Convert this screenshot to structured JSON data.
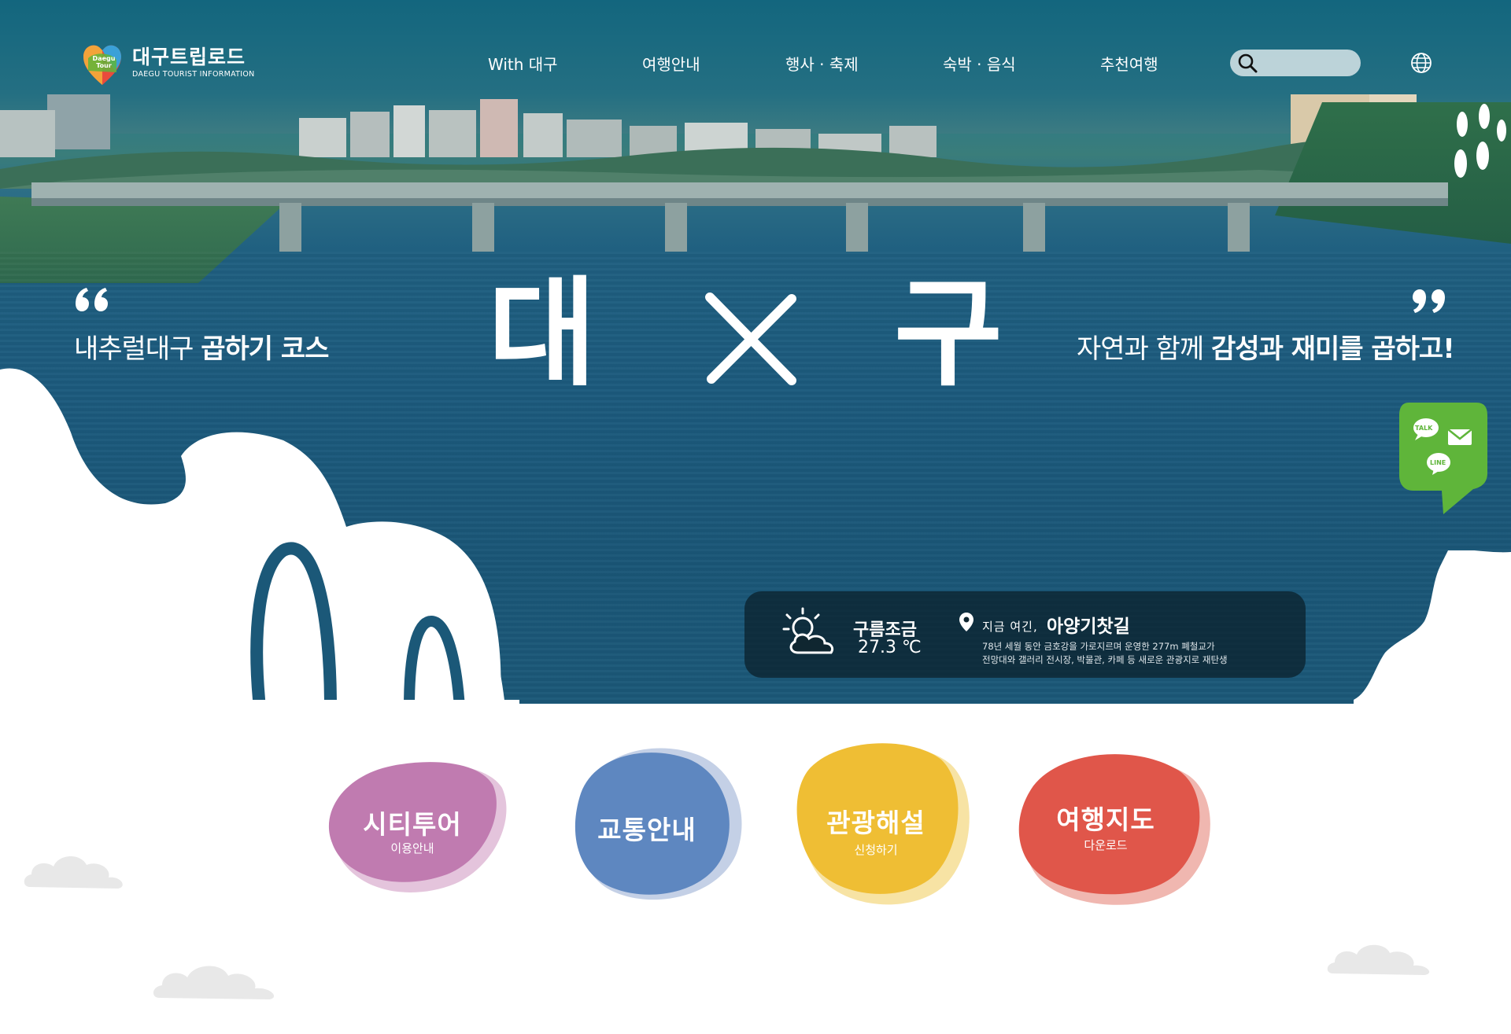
{
  "header": {
    "logo_badge": "Daegu Tour",
    "logo_title": "대구트립로드",
    "logo_subtitle": "DAEGU TOURIST INFORMATION",
    "nav": [
      "With 대구",
      "여행안내",
      "행사 · 축제",
      "숙박 · 음식",
      "추천여행"
    ],
    "search_placeholder": ""
  },
  "hero": {
    "tagline_left_plain": "내추럴대구 ",
    "tagline_left_bold": "곱하기 코스",
    "big_left": "대",
    "big_right": "구",
    "tagline_right_plain": "자연과 함께 ",
    "tagline_right_bold": "감성과 재미를 곱하고!"
  },
  "weather": {
    "condition": "구름조금",
    "temperature": "27.3 ℃",
    "now_here_label": "지금 여긴,",
    "place_name": "아양기찻길",
    "place_desc_line1": "78년 세월 동안 금호강을 가로지르며 운영한 277m 폐철교가",
    "place_desc_line2": "전망대와 갤러리 전시장, 박물관, 카페 등 새로운 관광지로 재탄생"
  },
  "chat_widget": {
    "talk_label": "TALK",
    "line_label": "LINE"
  },
  "quick_links": [
    {
      "title": "시티투어",
      "subtitle": "이용안내",
      "color": "#c07bb0",
      "shadow": "#e4c4dc"
    },
    {
      "title": "교통안내",
      "subtitle": "",
      "color": "#5e87c0",
      "shadow": "#c4d0e6"
    },
    {
      "title": "관광해설",
      "subtitle": "신청하기",
      "color": "#efbe34",
      "shadow": "#f7e3a4"
    },
    {
      "title": "여행지도",
      "subtitle": "다운로드",
      "color": "#e0564a",
      "shadow": "#f0b7b0"
    }
  ],
  "colors": {
    "hero_water": "#1c5a7d",
    "chat_green": "#5fb53a",
    "panel_bg": "#0a1e28"
  }
}
